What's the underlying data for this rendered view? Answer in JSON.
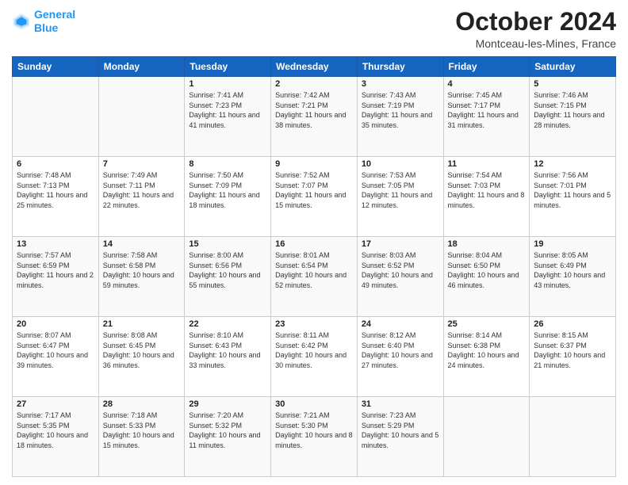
{
  "header": {
    "logo_line1": "General",
    "logo_line2": "Blue",
    "month": "October 2024",
    "location": "Montceau-les-Mines, France"
  },
  "days_of_week": [
    "Sunday",
    "Monday",
    "Tuesday",
    "Wednesday",
    "Thursday",
    "Friday",
    "Saturday"
  ],
  "weeks": [
    [
      {
        "day": "",
        "sunrise": "",
        "sunset": "",
        "daylight": ""
      },
      {
        "day": "",
        "sunrise": "",
        "sunset": "",
        "daylight": ""
      },
      {
        "day": "1",
        "sunrise": "Sunrise: 7:41 AM",
        "sunset": "Sunset: 7:23 PM",
        "daylight": "Daylight: 11 hours and 41 minutes."
      },
      {
        "day": "2",
        "sunrise": "Sunrise: 7:42 AM",
        "sunset": "Sunset: 7:21 PM",
        "daylight": "Daylight: 11 hours and 38 minutes."
      },
      {
        "day": "3",
        "sunrise": "Sunrise: 7:43 AM",
        "sunset": "Sunset: 7:19 PM",
        "daylight": "Daylight: 11 hours and 35 minutes."
      },
      {
        "day": "4",
        "sunrise": "Sunrise: 7:45 AM",
        "sunset": "Sunset: 7:17 PM",
        "daylight": "Daylight: 11 hours and 31 minutes."
      },
      {
        "day": "5",
        "sunrise": "Sunrise: 7:46 AM",
        "sunset": "Sunset: 7:15 PM",
        "daylight": "Daylight: 11 hours and 28 minutes."
      }
    ],
    [
      {
        "day": "6",
        "sunrise": "Sunrise: 7:48 AM",
        "sunset": "Sunset: 7:13 PM",
        "daylight": "Daylight: 11 hours and 25 minutes."
      },
      {
        "day": "7",
        "sunrise": "Sunrise: 7:49 AM",
        "sunset": "Sunset: 7:11 PM",
        "daylight": "Daylight: 11 hours and 22 minutes."
      },
      {
        "day": "8",
        "sunrise": "Sunrise: 7:50 AM",
        "sunset": "Sunset: 7:09 PM",
        "daylight": "Daylight: 11 hours and 18 minutes."
      },
      {
        "day": "9",
        "sunrise": "Sunrise: 7:52 AM",
        "sunset": "Sunset: 7:07 PM",
        "daylight": "Daylight: 11 hours and 15 minutes."
      },
      {
        "day": "10",
        "sunrise": "Sunrise: 7:53 AM",
        "sunset": "Sunset: 7:05 PM",
        "daylight": "Daylight: 11 hours and 12 minutes."
      },
      {
        "day": "11",
        "sunrise": "Sunrise: 7:54 AM",
        "sunset": "Sunset: 7:03 PM",
        "daylight": "Daylight: 11 hours and 8 minutes."
      },
      {
        "day": "12",
        "sunrise": "Sunrise: 7:56 AM",
        "sunset": "Sunset: 7:01 PM",
        "daylight": "Daylight: 11 hours and 5 minutes."
      }
    ],
    [
      {
        "day": "13",
        "sunrise": "Sunrise: 7:57 AM",
        "sunset": "Sunset: 6:59 PM",
        "daylight": "Daylight: 11 hours and 2 minutes."
      },
      {
        "day": "14",
        "sunrise": "Sunrise: 7:58 AM",
        "sunset": "Sunset: 6:58 PM",
        "daylight": "Daylight: 10 hours and 59 minutes."
      },
      {
        "day": "15",
        "sunrise": "Sunrise: 8:00 AM",
        "sunset": "Sunset: 6:56 PM",
        "daylight": "Daylight: 10 hours and 55 minutes."
      },
      {
        "day": "16",
        "sunrise": "Sunrise: 8:01 AM",
        "sunset": "Sunset: 6:54 PM",
        "daylight": "Daylight: 10 hours and 52 minutes."
      },
      {
        "day": "17",
        "sunrise": "Sunrise: 8:03 AM",
        "sunset": "Sunset: 6:52 PM",
        "daylight": "Daylight: 10 hours and 49 minutes."
      },
      {
        "day": "18",
        "sunrise": "Sunrise: 8:04 AM",
        "sunset": "Sunset: 6:50 PM",
        "daylight": "Daylight: 10 hours and 46 minutes."
      },
      {
        "day": "19",
        "sunrise": "Sunrise: 8:05 AM",
        "sunset": "Sunset: 6:49 PM",
        "daylight": "Daylight: 10 hours and 43 minutes."
      }
    ],
    [
      {
        "day": "20",
        "sunrise": "Sunrise: 8:07 AM",
        "sunset": "Sunset: 6:47 PM",
        "daylight": "Daylight: 10 hours and 39 minutes."
      },
      {
        "day": "21",
        "sunrise": "Sunrise: 8:08 AM",
        "sunset": "Sunset: 6:45 PM",
        "daylight": "Daylight: 10 hours and 36 minutes."
      },
      {
        "day": "22",
        "sunrise": "Sunrise: 8:10 AM",
        "sunset": "Sunset: 6:43 PM",
        "daylight": "Daylight: 10 hours and 33 minutes."
      },
      {
        "day": "23",
        "sunrise": "Sunrise: 8:11 AM",
        "sunset": "Sunset: 6:42 PM",
        "daylight": "Daylight: 10 hours and 30 minutes."
      },
      {
        "day": "24",
        "sunrise": "Sunrise: 8:12 AM",
        "sunset": "Sunset: 6:40 PM",
        "daylight": "Daylight: 10 hours and 27 minutes."
      },
      {
        "day": "25",
        "sunrise": "Sunrise: 8:14 AM",
        "sunset": "Sunset: 6:38 PM",
        "daylight": "Daylight: 10 hours and 24 minutes."
      },
      {
        "day": "26",
        "sunrise": "Sunrise: 8:15 AM",
        "sunset": "Sunset: 6:37 PM",
        "daylight": "Daylight: 10 hours and 21 minutes."
      }
    ],
    [
      {
        "day": "27",
        "sunrise": "Sunrise: 7:17 AM",
        "sunset": "Sunset: 5:35 PM",
        "daylight": "Daylight: 10 hours and 18 minutes."
      },
      {
        "day": "28",
        "sunrise": "Sunrise: 7:18 AM",
        "sunset": "Sunset: 5:33 PM",
        "daylight": "Daylight: 10 hours and 15 minutes."
      },
      {
        "day": "29",
        "sunrise": "Sunrise: 7:20 AM",
        "sunset": "Sunset: 5:32 PM",
        "daylight": "Daylight: 10 hours and 11 minutes."
      },
      {
        "day": "30",
        "sunrise": "Sunrise: 7:21 AM",
        "sunset": "Sunset: 5:30 PM",
        "daylight": "Daylight: 10 hours and 8 minutes."
      },
      {
        "day": "31",
        "sunrise": "Sunrise: 7:23 AM",
        "sunset": "Sunset: 5:29 PM",
        "daylight": "Daylight: 10 hours and 5 minutes."
      },
      {
        "day": "",
        "sunrise": "",
        "sunset": "",
        "daylight": ""
      },
      {
        "day": "",
        "sunrise": "",
        "sunset": "",
        "daylight": ""
      }
    ]
  ]
}
